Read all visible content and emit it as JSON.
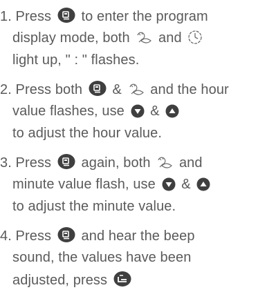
{
  "colors": {
    "text": "#5a5a5a",
    "icon_fill": "#3f3f3f"
  },
  "icons": {
    "program": "program-button-icon",
    "timer": "timer-dial-icon",
    "clock": "clock-icon",
    "down": "down-arrow-button-icon",
    "up": "up-arrow-button-icon",
    "exit": "exit-button-icon"
  },
  "steps": [
    {
      "l1_a": "1. Press",
      "l1_b": "to enter the program",
      "l2_a": "display mode, both",
      "l2_b": "and",
      "l3": "light up, \" : \" flashes."
    },
    {
      "l1_a": "2. Press both",
      "l1_b": "&",
      "l1_c": "and the hour",
      "l2_a": "value flashes, use",
      "l2_b": "&",
      "l3": "to adjust the hour value."
    },
    {
      "l1_a": "3. Press",
      "l1_b": "again, both",
      "l1_c": "and",
      "l2_a": "minute value flash, use",
      "l2_b": "&",
      "l3": "to adjust the minute value."
    },
    {
      "l1_a": "4. Press",
      "l1_b": "and hear the beep",
      "l2": "sound, the values have been",
      "l3_a": "adjusted, press"
    }
  ]
}
